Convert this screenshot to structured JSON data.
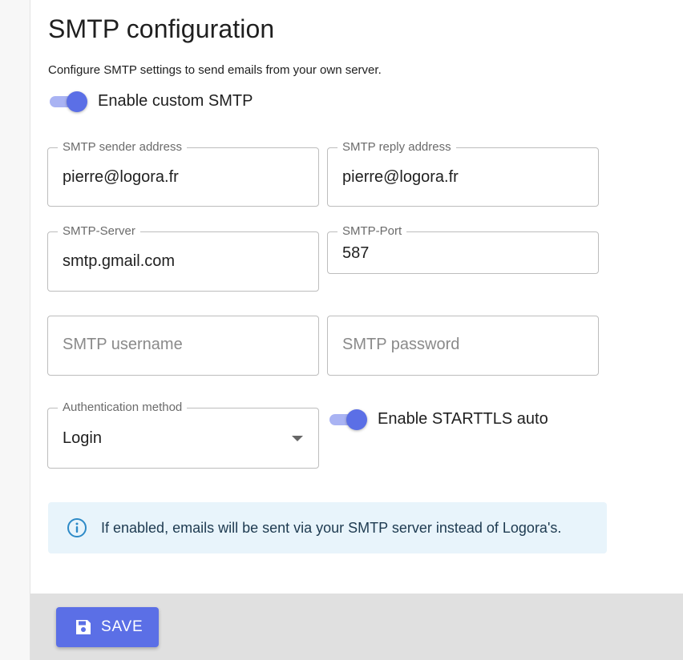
{
  "page": {
    "title": "SMTP configuration",
    "description": "Configure SMTP settings to send emails from your own server."
  },
  "custom_smtp": {
    "label": "Enable custom SMTP",
    "enabled": true
  },
  "fields": {
    "sender_address": {
      "label": "SMTP sender address",
      "value": "pierre@logora.fr"
    },
    "reply_address": {
      "label": "SMTP reply address",
      "value": "pierre@logora.fr"
    },
    "server": {
      "label": "SMTP-Server",
      "value": "smtp.gmail.com"
    },
    "port": {
      "label": "SMTP-Port",
      "value": "587"
    },
    "username": {
      "placeholder": "SMTP username",
      "value": ""
    },
    "password": {
      "placeholder": "SMTP password",
      "value": ""
    },
    "auth_method": {
      "label": "Authentication method",
      "value": "Login"
    }
  },
  "starttls": {
    "label": "Enable STARTTLS auto",
    "enabled": true
  },
  "info": {
    "icon": "info-circle-icon",
    "text": "If enabled, emails will be sent via your SMTP server instead of Logora's."
  },
  "footer": {
    "save_label": "SAVE",
    "save_icon": "floppy-disk-icon"
  },
  "colors": {
    "primary": "#5b6fe6",
    "switch_track": "#a9b3f3",
    "info_bg": "#e8f4fb",
    "info_icon": "#2d8ac7",
    "footer_bg": "#e0e0e0"
  }
}
